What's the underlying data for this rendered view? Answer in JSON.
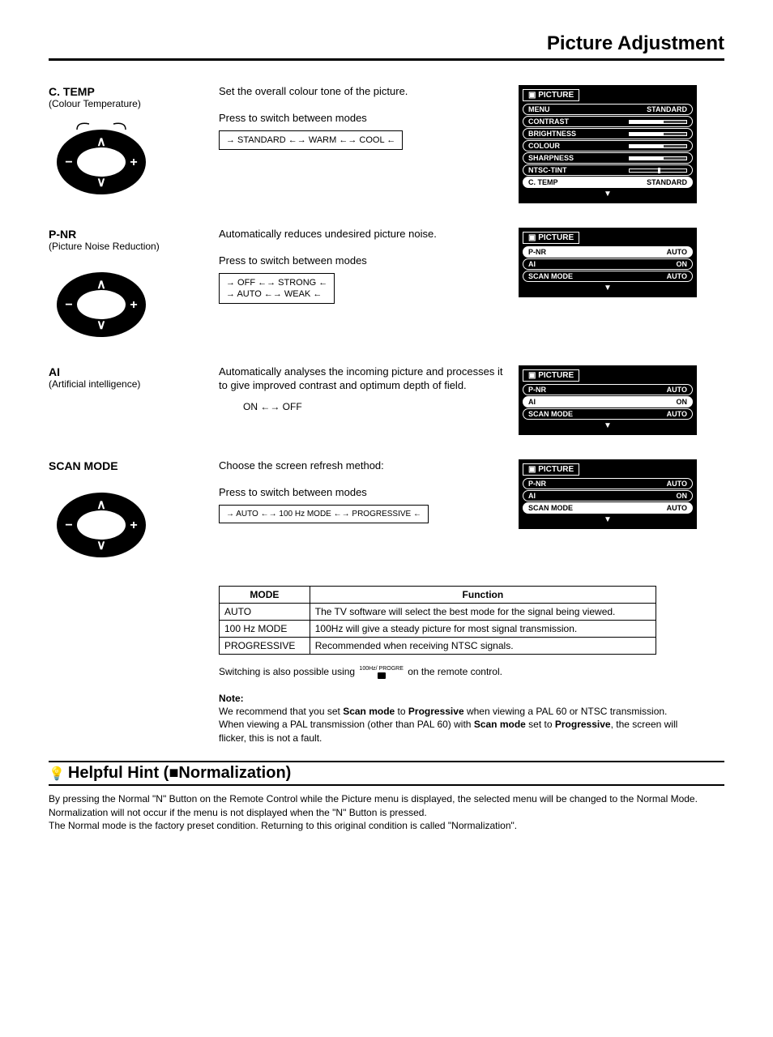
{
  "page_title": "Picture Adjustment",
  "sections": {
    "ctemp": {
      "title": "C. TEMP",
      "subtitle": "(Colour Temperature)",
      "desc": "Set the overall colour tone of the picture.",
      "press": "Press to switch between modes",
      "cycle": "→ STANDARD ←→ WARM ←→ COOL ←"
    },
    "pnr": {
      "title": "P-NR",
      "subtitle": "(Picture Noise Reduction)",
      "desc": "Automatically reduces undesired picture noise.",
      "press": "Press to switch between modes",
      "cycle_l1": "→ OFF ←→ STRONG ←",
      "cycle_l2": "→ AUTO ←→ WEAK ←"
    },
    "ai": {
      "title": "AI",
      "subtitle": "(Artificial intelligence)",
      "desc": "Automatically analyses the incoming picture and processes it to give improved contrast and optimum depth of field.",
      "cycle": "ON ←→ OFF"
    },
    "scan": {
      "title": "SCAN MODE",
      "desc": "Choose the screen refresh method:",
      "press": "Press to switch between modes",
      "cycle": "→ AUTO ←→ 100 Hz MODE ←→ PROGRESSIVE ←"
    }
  },
  "osd": {
    "title": "PICTURE",
    "ctemp_rows": [
      {
        "l": "MENU",
        "v": "STANDARD"
      },
      {
        "l": "CONTRAST",
        "bar": true
      },
      {
        "l": "BRIGHTNESS",
        "bar": true
      },
      {
        "l": "COLOUR",
        "bar": true
      },
      {
        "l": "SHARPNESS",
        "bar": true
      },
      {
        "l": "NTSC-TINT",
        "barmid": true
      },
      {
        "l": "C. TEMP",
        "v": "STANDARD",
        "hl": true
      }
    ],
    "pnr_rows": [
      {
        "l": "P-NR",
        "v": "AUTO",
        "hl": true
      },
      {
        "l": "AI",
        "v": "ON"
      },
      {
        "l": "SCAN MODE",
        "v": "AUTO"
      }
    ],
    "ai_rows": [
      {
        "l": "P-NR",
        "v": "AUTO"
      },
      {
        "l": "AI",
        "v": "ON",
        "hl": true
      },
      {
        "l": "SCAN MODE",
        "v": "AUTO"
      }
    ],
    "scan_rows": [
      {
        "l": "P-NR",
        "v": "AUTO"
      },
      {
        "l": "AI",
        "v": "ON"
      },
      {
        "l": "SCAN MODE",
        "v": "AUTO",
        "hl": true
      }
    ]
  },
  "table": {
    "h1": "MODE",
    "h2": "Function",
    "rows": [
      {
        "m": "AUTO",
        "f": "The TV software will select the best mode for the signal being viewed."
      },
      {
        "m": "100 Hz MODE",
        "f": "100Hz will give a steady picture for most signal transmission."
      },
      {
        "m": "PROGRESSIVE",
        "f": "Recommended when receiving NTSC signals."
      }
    ]
  },
  "switching_pre": "Switching is also possible using ",
  "switching_btn": "100Hz/ PROGRE",
  "switching_post": " on the remote control.",
  "note_title": "Note:",
  "note_body": "We recommend that you set Scan mode to Progressive when viewing a PAL 60 or NTSC transmission. When viewing a PAL transmission (other than PAL 60) with Scan mode set to Progressive, the screen will flicker, this is not a fault.",
  "hint_title": "Helpful Hint (■Normalization)",
  "hint_body_1": "By pressing the Normal \"N\" Button on the Remote Control while the Picture menu is displayed, the selected menu will be changed to the Normal Mode.",
  "hint_body_2": "Normalization will not occur if the menu is not displayed when the \"N\" Button is pressed.",
  "hint_body_3": "The Normal mode is the factory preset condition. Returning to this original condition is called \"Normalization\"."
}
